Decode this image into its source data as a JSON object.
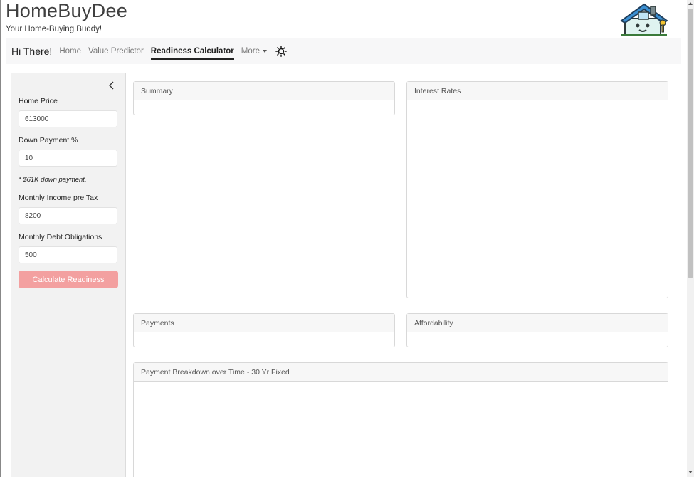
{
  "header": {
    "title": "HomeBuyDee",
    "subtitle": "Your Home-Buying Buddy!",
    "logo_icon": "house-mascot-icon"
  },
  "nav": {
    "greeting": "Hi There!",
    "links": [
      {
        "label": "Home",
        "active": false
      },
      {
        "label": "Value Predictor",
        "active": false
      },
      {
        "label": "Readiness Calculator",
        "active": true
      },
      {
        "label": "More",
        "active": false
      }
    ],
    "theme_icon": "sun-icon"
  },
  "sidebar": {
    "collapse_icon": "chevron-left-icon",
    "home_price_label": "Home Price",
    "home_price_value": "613000",
    "down_payment_label": "Down Payment %",
    "down_payment_value": "10",
    "down_payment_note": "* $61K down payment.",
    "income_label": "Monthly Income pre Tax",
    "income_value": "8200",
    "debt_label": "Monthly Debt Obligations",
    "debt_value": "500",
    "calculate_label": "Calculate Readiness"
  },
  "cards": {
    "summary": "Summary",
    "interest_rates": "Interest Rates",
    "payments": "Payments",
    "affordability": "Affordability",
    "breakdown": "Payment Breakdown over Time - 30 Yr Fixed"
  },
  "colors": {
    "accent_button": "#f3a0a0",
    "navbar_bg": "#f7f7f8",
    "sidebar_bg": "#f2f2f2"
  }
}
